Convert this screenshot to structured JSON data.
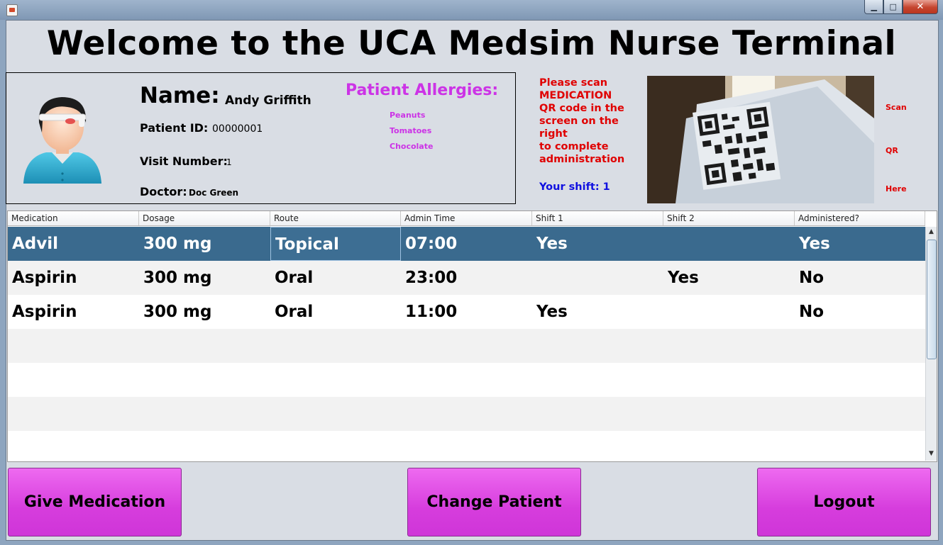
{
  "window": {
    "minimize_glyph": "▁",
    "maximize_glyph": "□",
    "close_glyph": "✕"
  },
  "title": "Welcome to the UCA Medsim Nurse Terminal",
  "patient": {
    "name_label": "Name:",
    "name": "Andy Griffith",
    "id_label": "Patient ID:",
    "id": "00000001",
    "visit_label": "Visit Number:",
    "visit": "1",
    "doctor_label": "Doctor:",
    "doctor": "Doc Green"
  },
  "allergies": {
    "title": "Patient Allergies:",
    "items": [
      "Peanuts",
      "Tomatoes",
      "Chocolate"
    ]
  },
  "scan": {
    "lines": [
      "Please scan",
      "MEDICATION",
      "QR code in the",
      "screen on the",
      "right",
      "to complete",
      "administration"
    ],
    "shift": "Your shift: 1",
    "side_labels": [
      "Scan",
      "QR",
      "Here"
    ]
  },
  "table": {
    "headers": [
      "Medication",
      "Dosage",
      "Route",
      "Admin Time",
      "Shift 1",
      "Shift 2",
      "Administered?"
    ],
    "rows": [
      [
        "Advil",
        "300 mg",
        "Topical",
        "07:00",
        "Yes",
        "",
        "Yes"
      ],
      [
        "Aspirin",
        "300 mg",
        "Oral",
        "23:00",
        "",
        "Yes",
        "No"
      ],
      [
        "Aspirin",
        "300 mg",
        "Oral",
        "11:00",
        "Yes",
        "",
        "No"
      ]
    ],
    "scroll_up": "▲",
    "scroll_down": "▼"
  },
  "buttons": {
    "give": "Give Medication",
    "change": "Change Patient",
    "logout": "Logout"
  },
  "colors": {
    "allergy": "#cc33e6",
    "scan_text": "#e00000",
    "shift_text": "#1010e0",
    "selected_row": "#3a6a8e",
    "button": "#d63ddd"
  }
}
